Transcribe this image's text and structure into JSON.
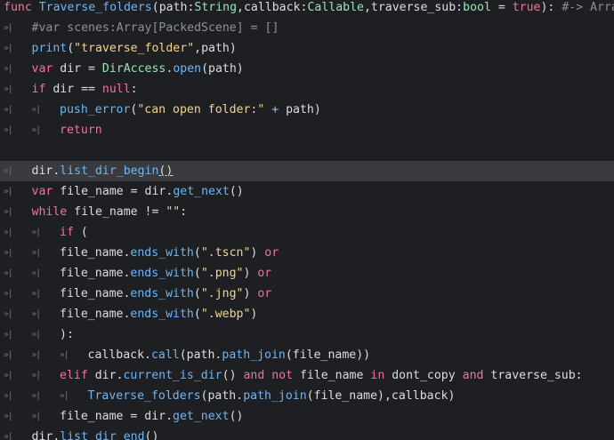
{
  "editor": {
    "tab_marker": "»|",
    "lines": [
      {
        "indent": 0,
        "tokens": [
          {
            "t": "func ",
            "c": "kw"
          },
          {
            "t": "Traverse_folders",
            "c": "fn"
          },
          {
            "t": "(path:",
            "c": "plain"
          },
          {
            "t": "String",
            "c": "cls"
          },
          {
            "t": ",callback:",
            "c": "plain"
          },
          {
            "t": "Callable",
            "c": "cls"
          },
          {
            "t": ",traverse_sub:",
            "c": "plain"
          },
          {
            "t": "bool",
            "c": "cls"
          },
          {
            "t": " = ",
            "c": "plain"
          },
          {
            "t": "true",
            "c": "kw"
          },
          {
            "t": "): ",
            "c": "plain"
          },
          {
            "t": "#-> Array",
            "c": "cmt"
          }
        ]
      },
      {
        "indent": 1,
        "tokens": [
          {
            "t": "#var scenes:Array[PackedScene] = []",
            "c": "cmt"
          }
        ]
      },
      {
        "indent": 1,
        "tokens": [
          {
            "t": "print",
            "c": "fn"
          },
          {
            "t": "(",
            "c": "plain"
          },
          {
            "t": "\"traverse_folder\"",
            "c": "str"
          },
          {
            "t": ",path)",
            "c": "plain"
          }
        ]
      },
      {
        "indent": 1,
        "tokens": [
          {
            "t": "var ",
            "c": "kw"
          },
          {
            "t": "dir = ",
            "c": "plain"
          },
          {
            "t": "DirAccess",
            "c": "cls"
          },
          {
            "t": ".",
            "c": "plain"
          },
          {
            "t": "open",
            "c": "fn"
          },
          {
            "t": "(path)",
            "c": "plain"
          }
        ]
      },
      {
        "indent": 1,
        "tokens": [
          {
            "t": "if ",
            "c": "kw"
          },
          {
            "t": "dir == ",
            "c": "plain"
          },
          {
            "t": "null",
            "c": "kw"
          },
          {
            "t": ":",
            "c": "plain"
          }
        ]
      },
      {
        "indent": 2,
        "tokens": [
          {
            "t": "push_error",
            "c": "fn"
          },
          {
            "t": "(",
            "c": "plain"
          },
          {
            "t": "\"can open folder:\"",
            "c": "str"
          },
          {
            "t": " + ",
            "c": "op"
          },
          {
            "t": "path)",
            "c": "plain"
          }
        ]
      },
      {
        "indent": 2,
        "tokens": [
          {
            "t": "return",
            "c": "kw"
          }
        ]
      },
      {
        "indent": 0,
        "tokens": []
      },
      {
        "indent": 1,
        "current": true,
        "tokens": [
          {
            "t": "dir.",
            "c": "plain"
          },
          {
            "t": "list_dir_begin",
            "c": "fn"
          },
          {
            "t": "()",
            "c": "plain",
            "u": true
          }
        ]
      },
      {
        "indent": 1,
        "tokens": [
          {
            "t": "var ",
            "c": "kw"
          },
          {
            "t": "file_name = dir.",
            "c": "plain"
          },
          {
            "t": "get_next",
            "c": "fn"
          },
          {
            "t": "()",
            "c": "plain"
          }
        ]
      },
      {
        "indent": 1,
        "tokens": [
          {
            "t": "while ",
            "c": "kw"
          },
          {
            "t": "file_name != ",
            "c": "plain"
          },
          {
            "t": "\"\"",
            "c": "str"
          },
          {
            "t": ":",
            "c": "plain"
          }
        ]
      },
      {
        "indent": 2,
        "tokens": [
          {
            "t": "if ",
            "c": "kw"
          },
          {
            "t": "(",
            "c": "plain"
          }
        ]
      },
      {
        "indent": 2,
        "tokens": [
          {
            "t": "file_name.",
            "c": "plain"
          },
          {
            "t": "ends_with",
            "c": "fn"
          },
          {
            "t": "(",
            "c": "plain"
          },
          {
            "t": "\".tscn\"",
            "c": "str"
          },
          {
            "t": ") ",
            "c": "plain"
          },
          {
            "t": "or",
            "c": "kw"
          }
        ]
      },
      {
        "indent": 2,
        "tokens": [
          {
            "t": "file_name.",
            "c": "plain"
          },
          {
            "t": "ends_with",
            "c": "fn"
          },
          {
            "t": "(",
            "c": "plain"
          },
          {
            "t": "\".png\"",
            "c": "str"
          },
          {
            "t": ") ",
            "c": "plain"
          },
          {
            "t": "or",
            "c": "kw"
          }
        ]
      },
      {
        "indent": 2,
        "tokens": [
          {
            "t": "file_name.",
            "c": "plain"
          },
          {
            "t": "ends_with",
            "c": "fn"
          },
          {
            "t": "(",
            "c": "plain"
          },
          {
            "t": "\".jng\"",
            "c": "str"
          },
          {
            "t": ") ",
            "c": "plain"
          },
          {
            "t": "or",
            "c": "kw"
          }
        ]
      },
      {
        "indent": 2,
        "tokens": [
          {
            "t": "file_name.",
            "c": "plain"
          },
          {
            "t": "ends_with",
            "c": "fn"
          },
          {
            "t": "(",
            "c": "plain"
          },
          {
            "t": "\".webp\"",
            "c": "str"
          },
          {
            "t": ")",
            "c": "plain"
          }
        ]
      },
      {
        "indent": 2,
        "tokens": [
          {
            "t": "):",
            "c": "plain"
          }
        ]
      },
      {
        "indent": 3,
        "tokens": [
          {
            "t": "callback.",
            "c": "plain"
          },
          {
            "t": "call",
            "c": "fn"
          },
          {
            "t": "(path.",
            "c": "plain"
          },
          {
            "t": "path_join",
            "c": "fn"
          },
          {
            "t": "(file_name))",
            "c": "plain"
          }
        ]
      },
      {
        "indent": 2,
        "tokens": [
          {
            "t": "elif ",
            "c": "kw"
          },
          {
            "t": "dir.",
            "c": "plain"
          },
          {
            "t": "current_is_dir",
            "c": "fn"
          },
          {
            "t": "() ",
            "c": "plain"
          },
          {
            "t": "and not ",
            "c": "kw"
          },
          {
            "t": "file_name ",
            "c": "plain"
          },
          {
            "t": "in ",
            "c": "kw"
          },
          {
            "t": "dont_copy ",
            "c": "plain"
          },
          {
            "t": "and ",
            "c": "kw"
          },
          {
            "t": "traverse_sub:",
            "c": "plain"
          }
        ]
      },
      {
        "indent": 3,
        "tokens": [
          {
            "t": "Traverse_folders",
            "c": "fn"
          },
          {
            "t": "(path.",
            "c": "plain"
          },
          {
            "t": "path_join",
            "c": "fn"
          },
          {
            "t": "(file_name),callback)",
            "c": "plain"
          }
        ]
      },
      {
        "indent": 2,
        "tokens": [
          {
            "t": "file_name = dir.",
            "c": "plain"
          },
          {
            "t": "get_next",
            "c": "fn"
          },
          {
            "t": "()",
            "c": "plain"
          }
        ]
      },
      {
        "indent": 1,
        "tokens": [
          {
            "t": "dir.",
            "c": "plain"
          },
          {
            "t": "list_dir_end",
            "c": "fn"
          },
          {
            "t": "()",
            "c": "plain"
          }
        ]
      }
    ]
  }
}
